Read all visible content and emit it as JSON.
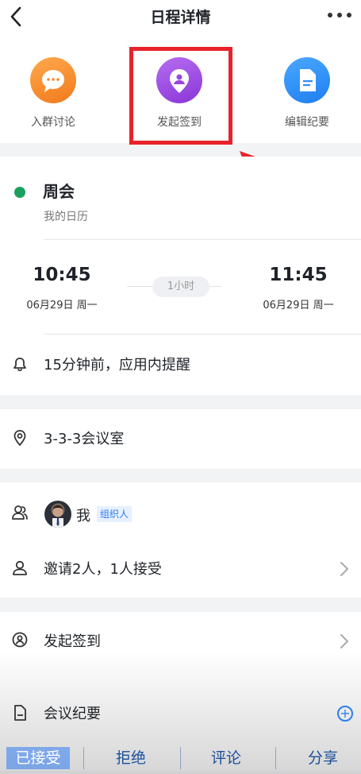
{
  "header": {
    "title": "日程详情",
    "back_icon": "chevron-left-icon",
    "more_icon": "ellipsis-icon"
  },
  "actions": [
    {
      "label": "入群讨论",
      "icon": "chat-bubble-icon",
      "color": "#f58a2e"
    },
    {
      "label": "发起签到",
      "icon": "location-pin-icon",
      "color": "#9b45e0"
    },
    {
      "label": "编辑纪要",
      "icon": "document-icon",
      "color": "#2f8cf5"
    }
  ],
  "event": {
    "title": "周会",
    "calendar": "我的日历",
    "status_color": "#1aa05d",
    "start_time": "10:45",
    "start_date": "06月29日 周一",
    "end_time": "11:45",
    "end_date": "06月29日 周一",
    "duration": "1小时",
    "reminder": "15分钟前，应用内提醒"
  },
  "location": "3-3-3会议室",
  "attendees": {
    "me": "我",
    "organizer_tag": "组织人",
    "invite_summary": "邀请2人，1人接受"
  },
  "checkin": {
    "label": "发起签到"
  },
  "minutes": {
    "label": "会议纪要"
  },
  "bottom_bar": {
    "accepted": "已接受",
    "reject": "拒绝",
    "comment": "评论",
    "share": "分享"
  }
}
